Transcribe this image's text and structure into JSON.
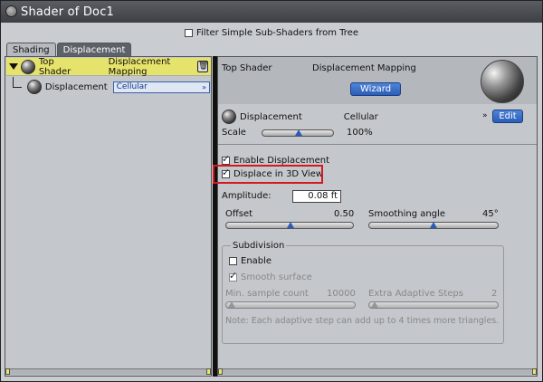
{
  "window": {
    "title": "Shader of Doc1"
  },
  "filter": {
    "label": "Filter Simple Sub-Shaders from Tree",
    "checked": false
  },
  "tabs": [
    {
      "label": "Shading",
      "active": false
    },
    {
      "label": "Displacement",
      "active": true
    }
  ],
  "tree": {
    "top": {
      "label": "Top Shader",
      "type": "Displacement Mapping"
    },
    "child": {
      "label": "Displacement",
      "value": "Cellular"
    }
  },
  "panel": {
    "header_left": "Top Shader",
    "header_right": "Displacement Mapping",
    "wizard_label": "Wizard",
    "shader_label": "Displacement",
    "shader_value": "Cellular",
    "edit_label": "Edit",
    "scale_label": "Scale",
    "scale_value": "100%",
    "enable_displacement": "Enable Displacement",
    "displace_3d": "Displace in 3D View",
    "amplitude_label": "Amplitude:",
    "amplitude_value": "0.08 ft",
    "offset_label": "Offset",
    "offset_value": "0.50",
    "smoothing_label": "Smoothing angle",
    "smoothing_value": "45°",
    "subdivision_title": "Subdivision",
    "enable_label": "Enable",
    "smooth_surface": "Smooth surface",
    "min_sample_label": "Min. sample count",
    "min_sample_value": "10000",
    "adaptive_label": "Extra Adaptive Steps",
    "adaptive_value": "2",
    "note": "Note: Each adaptive step can add up to 4 times more triangles."
  },
  "icons": {
    "menu": "chevron-down-icon",
    "trash": "trash-icon"
  },
  "colors": {
    "selection": "#e6e36c",
    "accent_blue": "#2b5db8",
    "highlight_red": "#d41920"
  }
}
